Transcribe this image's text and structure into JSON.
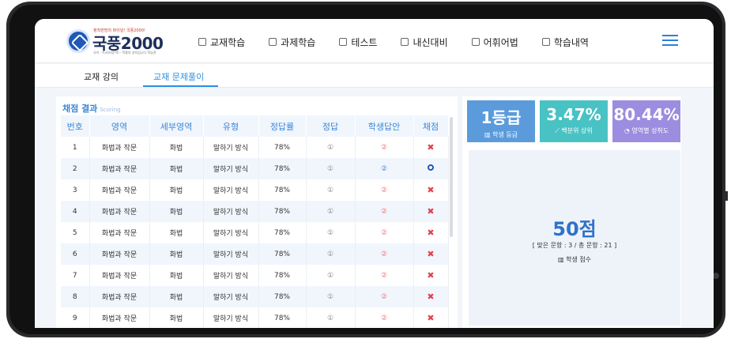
{
  "logo": {
    "tagline": "정직한방의 파이널! 국풍2000!",
    "name": "국풍2000",
    "subtitle": "국어 · 독서(비문학) · 학종의 성지입니다 학습관"
  },
  "nav": {
    "items": [
      {
        "label": "교재학습",
        "icon": "book-icon"
      },
      {
        "label": "과제학습",
        "icon": "clipboard-icon"
      },
      {
        "label": "테스트",
        "icon": "chart-line-icon"
      },
      {
        "label": "내신대비",
        "icon": "edit-icon"
      },
      {
        "label": "어휘어법",
        "icon": "monitor-icon"
      },
      {
        "label": "학습내역",
        "icon": "list-icon"
      }
    ],
    "menu_icon": "hamburger-icon"
  },
  "subnav": {
    "tabs": [
      {
        "label": "교재 강의",
        "active": false
      },
      {
        "label": "교재 문제풀이",
        "active": true
      }
    ]
  },
  "scoring": {
    "title": "채점 결과",
    "title_en": "Scoring",
    "columns": [
      "번호",
      "영역",
      "세부영역",
      "유형",
      "정답률",
      "정답",
      "학생답안",
      "채점"
    ],
    "rows": [
      {
        "no": "1",
        "area": "화법과 작문",
        "sub": "화법",
        "type": "말하기 방식",
        "rate": "78%",
        "answer": "①",
        "student": "②",
        "correct": false
      },
      {
        "no": "2",
        "area": "화법과 작문",
        "sub": "화법",
        "type": "말하기 방식",
        "rate": "78%",
        "answer": "①",
        "student": "②",
        "correct": true
      },
      {
        "no": "3",
        "area": "화법과 작문",
        "sub": "화법",
        "type": "말하기 방식",
        "rate": "78%",
        "answer": "①",
        "student": "②",
        "correct": false
      },
      {
        "no": "4",
        "area": "화법과 작문",
        "sub": "화법",
        "type": "말하기 방식",
        "rate": "78%",
        "answer": "①",
        "student": "②",
        "correct": false
      },
      {
        "no": "5",
        "area": "화법과 작문",
        "sub": "화법",
        "type": "말하기 방식",
        "rate": "78%",
        "answer": "①",
        "student": "②",
        "correct": false
      },
      {
        "no": "6",
        "area": "화법과 작문",
        "sub": "화법",
        "type": "말하기 방식",
        "rate": "78%",
        "answer": "①",
        "student": "②",
        "correct": false
      },
      {
        "no": "7",
        "area": "화법과 작문",
        "sub": "화법",
        "type": "말하기 방식",
        "rate": "78%",
        "answer": "①",
        "student": "②",
        "correct": false
      },
      {
        "no": "8",
        "area": "화법과 작문",
        "sub": "화법",
        "type": "말하기 방식",
        "rate": "78%",
        "answer": "①",
        "student": "②",
        "correct": false
      },
      {
        "no": "9",
        "area": "화법과 작문",
        "sub": "화법",
        "type": "말하기 방식",
        "rate": "78%",
        "answer": "①",
        "student": "②",
        "correct": false
      }
    ]
  },
  "stats": [
    {
      "value": "1등급",
      "label": "학생 등급",
      "color": "#5b9bdc",
      "icon": "bar-chart-icon"
    },
    {
      "value": "3.47%",
      "label": "백분위 상위",
      "color": "#49c2c4",
      "icon": "trend-icon"
    },
    {
      "value": "80.44%",
      "label": "영역별 성취도",
      "color": "#9c8de0",
      "icon": "pie-chart-icon"
    }
  ],
  "score": {
    "value": "50점",
    "detail": "[ 맞은 문항 : 3 / 총 문항 : 21 ]",
    "label": "학생 점수",
    "icon": "bar-chart-icon"
  },
  "colors": {
    "accent": "#2f8fe0",
    "header_text": "#3b86d6",
    "wrong_mark": "#e0434e",
    "right_mark": "#1f58b8",
    "score_text": "#2f73c7"
  }
}
